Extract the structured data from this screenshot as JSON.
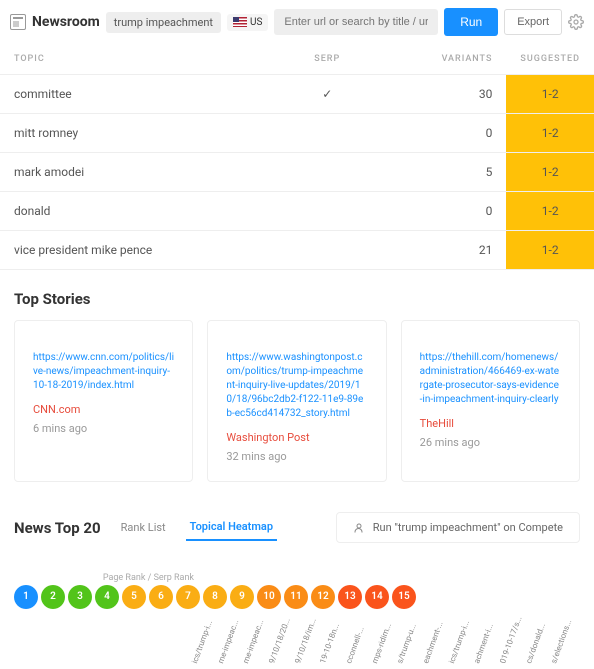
{
  "header": {
    "app": "Newsroom",
    "query_badge": "trump impeachment",
    "locale": "US",
    "search_placeholder": "Enter url or search by title / url",
    "run": "Run",
    "export": "Export"
  },
  "table": {
    "cols": {
      "topic": "TOPIC",
      "serp": "SERP",
      "variants": "VARIANTS",
      "suggested": "SUGGESTED"
    },
    "rows": [
      {
        "topic": "committee",
        "serp_check": true,
        "variants": 30,
        "suggested": "1-2"
      },
      {
        "topic": "mitt romney",
        "serp_check": false,
        "variants": 0,
        "suggested": "1-2"
      },
      {
        "topic": "mark amodei",
        "serp_check": false,
        "variants": 5,
        "suggested": "1-2"
      },
      {
        "topic": "donald",
        "serp_check": false,
        "variants": 0,
        "suggested": "1-2"
      },
      {
        "topic": "vice president mike pence",
        "serp_check": false,
        "variants": 21,
        "suggested": "1-2"
      }
    ]
  },
  "top_stories": {
    "title": "Top Stories",
    "items": [
      {
        "url": "https://www.cnn.com/politics/live-news/impeachment-inquiry-10-18-2019/index.html",
        "source": "CNN.com",
        "time": "6 mins ago"
      },
      {
        "url": "https://www.washingtonpost.com/politics/trump-impeachment-inquiry-live-updates/2019/10/18/96bc2db2-f122-11e9-89eb-ec56cd414732_story.html",
        "source": "Washington Post",
        "time": "32 mins ago"
      },
      {
        "url": "https://thehill.com/homenews/administration/466469-ex-watergate-prosecutor-says-evidence-in-impeachment-inquiry-clearly",
        "source": "TheHill",
        "time": "26 mins ago"
      }
    ]
  },
  "news20": {
    "title": "News Top 20",
    "tabs": {
      "rank": "Rank List",
      "heatmap": "Topical Heatmap"
    },
    "compete_label": "Run \"trump impeachment\" on Compete",
    "axis_label": "Page Rank / Serp Rank",
    "bubbles": [
      {
        "n": 1,
        "c": "#1890ff"
      },
      {
        "n": 2,
        "c": "#52c41a"
      },
      {
        "n": 3,
        "c": "#52c41a"
      },
      {
        "n": 4,
        "c": "#52c41a"
      },
      {
        "n": 5,
        "c": "#faad14"
      },
      {
        "n": 6,
        "c": "#faad14"
      },
      {
        "n": 7,
        "c": "#faad14"
      },
      {
        "n": 8,
        "c": "#faad14"
      },
      {
        "n": 9,
        "c": "#faad14"
      },
      {
        "n": 10,
        "c": "#fa8c16"
      },
      {
        "n": 11,
        "c": "#fa8c16"
      },
      {
        "n": 12,
        "c": "#fa8c16"
      },
      {
        "n": 13,
        "c": "#fa541c"
      },
      {
        "n": 14,
        "c": "#fa541c"
      },
      {
        "n": 15,
        "c": "#fa541c"
      }
    ],
    "cols": [
      "ics/trump-i...",
      "me-impeac...",
      "me-impeac...",
      "9/10/18/20...",
      "9/10/18/im...",
      "19-10-18n...",
      "cconnell-...",
      "mps-ridim...",
      "s/trump-u...",
      "eachment-...",
      "ics/trump-i...",
      "achment-i...",
      "019-10-17/s...",
      "cs/donald...",
      "s/elections..."
    ]
  }
}
